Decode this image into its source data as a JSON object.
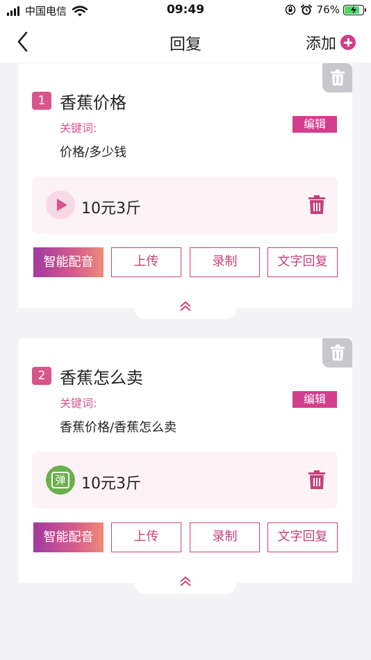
{
  "status_bar": {
    "carrier": "中国电信",
    "time": "09:49",
    "battery": "76%"
  },
  "nav": {
    "title": "回复",
    "add_label": "添加"
  },
  "colors": {
    "accent": "#d23e8c",
    "badge": "#d8558c",
    "delete_bg": "#c7c7cc",
    "reply_bg": "#fdf3f7",
    "danmu_green": "#6ab04c"
  },
  "replies": [
    {
      "number": "1",
      "title": "香蕉价格",
      "keyword_label": "关键词:",
      "edit_label": "编辑",
      "keywords": "价格/多少钱",
      "reply_type_icon": "play-icon",
      "reply_text": "10元3斤",
      "buttons": [
        "智能配音",
        "上传",
        "录制",
        "文字回复"
      ]
    },
    {
      "number": "2",
      "title": "香蕉怎么卖",
      "keyword_label": "关键词:",
      "edit_label": "编辑",
      "keywords": "香蕉价格/香蕉怎么卖",
      "reply_type_icon": "danmu-icon",
      "danmu_glyph": "弹",
      "reply_text": "10元3斤",
      "buttons": [
        "智能配音",
        "上传",
        "录制",
        "文字回复"
      ]
    }
  ]
}
